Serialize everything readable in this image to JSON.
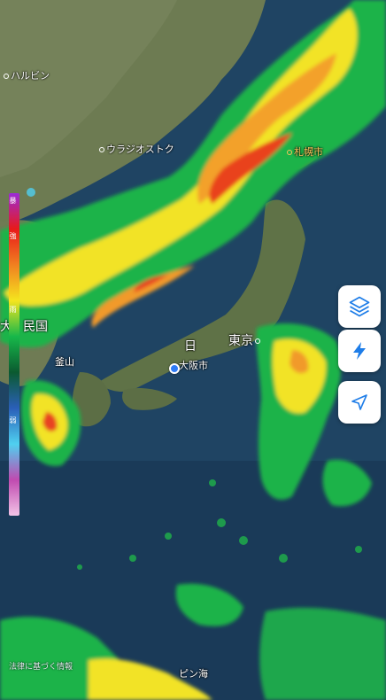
{
  "map": {
    "labels": {
      "harbin": "ハルビン",
      "vladivostok": "ウラジオストク",
      "sapporo": "札幌市",
      "tokyo": "東京",
      "osaka": "大阪市",
      "japan_char": "日",
      "busan": "釜山",
      "korea_partial_a": "大",
      "korea_partial_b": "民国",
      "sea_partial": "ピン海"
    },
    "legend": {
      "top_label": "暴",
      "upper_label": "強",
      "middle_label": "雨",
      "lower_label": "弱",
      "gradient_colors": [
        "#9b2bd8",
        "#e81a1a",
        "#f08020",
        "#f5e51e",
        "#17b84a",
        "#0b5a30",
        "#2a5fb8",
        "#4fd0f0",
        "#c04ab0",
        "#f2c4e6"
      ]
    },
    "attribution": "法律に基づく情報"
  },
  "controls": {
    "layers": "layers-icon",
    "lightning": "lightning-icon",
    "locate": "location-arrow-icon"
  }
}
